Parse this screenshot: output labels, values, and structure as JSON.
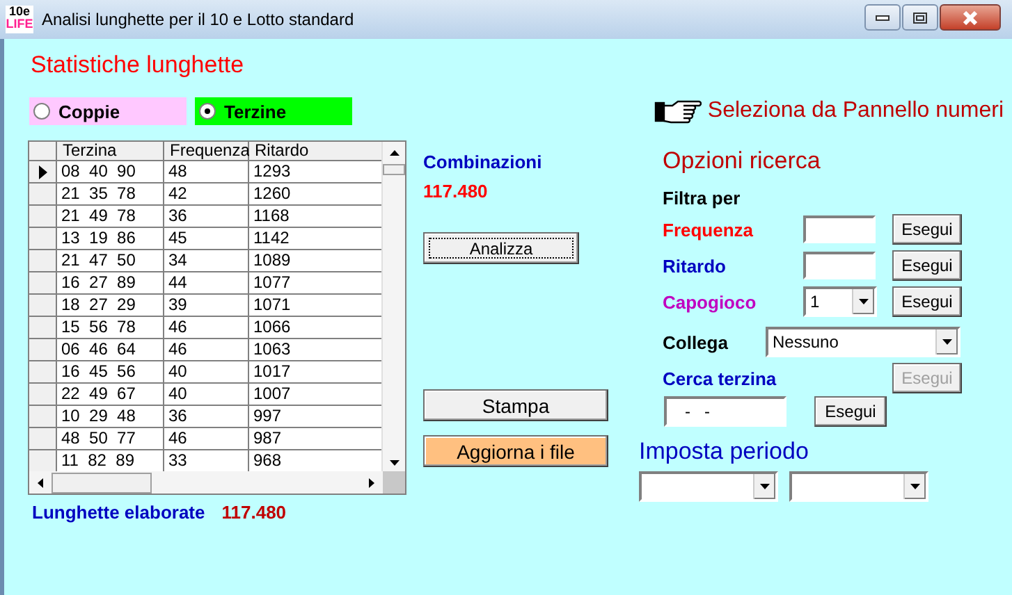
{
  "window": {
    "title": "Analisi lunghette per il 10 e Lotto standard",
    "logo_top": "10e",
    "logo_bottom": "LIFE"
  },
  "heading": "Statistiche lunghette",
  "modes": [
    {
      "label": "Coppie",
      "selected": false,
      "color": "#ffc8ff"
    },
    {
      "label": "Terzine",
      "selected": true,
      "color": "#00ff00"
    }
  ],
  "panel_link": "Seleziona da Pannello numeri",
  "table": {
    "columns": [
      "Terzina",
      "Frequenza",
      "Ritardo"
    ],
    "rows": [
      {
        "cells": [
          "08  40  90",
          "48",
          "1293"
        ],
        "current": true
      },
      {
        "cells": [
          "21  35  78",
          "42",
          "1260"
        ],
        "current": false
      },
      {
        "cells": [
          "21  49  78",
          "36",
          "1168"
        ],
        "current": false
      },
      {
        "cells": [
          "13  19  86",
          "45",
          "1142"
        ],
        "current": false
      },
      {
        "cells": [
          "21  47  50",
          "34",
          "1089"
        ],
        "current": false
      },
      {
        "cells": [
          "16  27  89",
          "44",
          "1077"
        ],
        "current": false
      },
      {
        "cells": [
          "18  27  29",
          "39",
          "1071"
        ],
        "current": false
      },
      {
        "cells": [
          "15  56  78",
          "46",
          "1066"
        ],
        "current": false
      },
      {
        "cells": [
          "06  46  64",
          "46",
          "1063"
        ],
        "current": false
      },
      {
        "cells": [
          "16  45  56",
          "40",
          "1017"
        ],
        "current": false
      },
      {
        "cells": [
          "22  49  67",
          "40",
          "1007"
        ],
        "current": false
      },
      {
        "cells": [
          "10  29  48",
          "36",
          "997"
        ],
        "current": false
      },
      {
        "cells": [
          "48  50  77",
          "46",
          "987"
        ],
        "current": false
      },
      {
        "cells": [
          "11  82  89",
          "33",
          "968"
        ],
        "current": false
      }
    ]
  },
  "processed": {
    "label": "Lunghette elaborate",
    "value": "117.480"
  },
  "combinations": {
    "label": "Combinazioni",
    "value": "117.480"
  },
  "actions": [
    {
      "label": "Analizza",
      "focused": true,
      "color": "#f0f0f0"
    },
    {
      "label": "Stampa",
      "focused": false,
      "color": "#f0f0f0"
    },
    {
      "label": "Aggiorna i file",
      "focused": false,
      "color": "#ffc080"
    }
  ],
  "search_options": {
    "title": "Opzioni ricerca",
    "filter_label": "Filtra per",
    "filters": [
      {
        "kind": "text",
        "label": "Frequenza",
        "color": "#ff0000",
        "button": "Esegui"
      },
      {
        "kind": "text",
        "label": "Ritardo",
        "color": "#0000c0",
        "button": "Esegui"
      },
      {
        "kind": "select",
        "label": "Capogioco",
        "color": "#c000c0",
        "value": "1",
        "button": "Esegui"
      }
    ],
    "link": {
      "label": "Collega",
      "value": "Nessuno"
    },
    "triplet_search": {
      "label": "Cerca terzina",
      "button": "Esegui",
      "button_disabled": true,
      "value": "-   -",
      "run_button": "Esegui"
    }
  },
  "period": {
    "title": "Imposta periodo"
  }
}
